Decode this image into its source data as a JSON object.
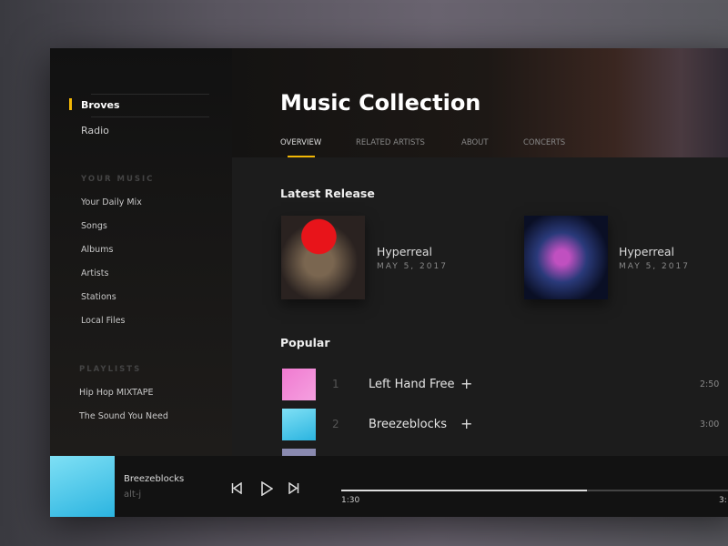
{
  "sidebar": {
    "primary": [
      {
        "label": "Broves",
        "active": true
      },
      {
        "label": "Radio"
      }
    ],
    "your_music_heading": "YOUR MUSIC",
    "your_music": [
      "Your Daily Mix",
      "Songs",
      "Albums",
      "Artists",
      "Stations",
      "Local Files"
    ],
    "playlists_heading": "PLAYLISTS",
    "playlists": [
      "Hip Hop MIXTAPE",
      "The Sound You Need"
    ]
  },
  "header": {
    "title": "Music Collection",
    "tabs": [
      "OVERVIEW",
      "RELATED ARTISTS",
      "ABOUT",
      "CONCERTS"
    ],
    "active_tab": "OVERVIEW"
  },
  "latest_release": {
    "heading": "Latest Release",
    "items": [
      {
        "name": "Hyperreal",
        "date": "MAY 5, 2017"
      },
      {
        "name": "Hyperreal",
        "date": "MAY 5, 2017"
      }
    ]
  },
  "popular": {
    "heading": "Popular",
    "tracks": [
      {
        "num": "1",
        "name": "Left Hand Free",
        "duration": "2:50"
      },
      {
        "num": "2",
        "name": "Breezeblocks",
        "duration": "3:00"
      }
    ]
  },
  "player": {
    "title": "Breezeblocks",
    "artist": "alt-j",
    "elapsed": "1:30",
    "total": "3:",
    "progress": 0.5
  },
  "colors": {
    "accent": "#f2b705"
  }
}
